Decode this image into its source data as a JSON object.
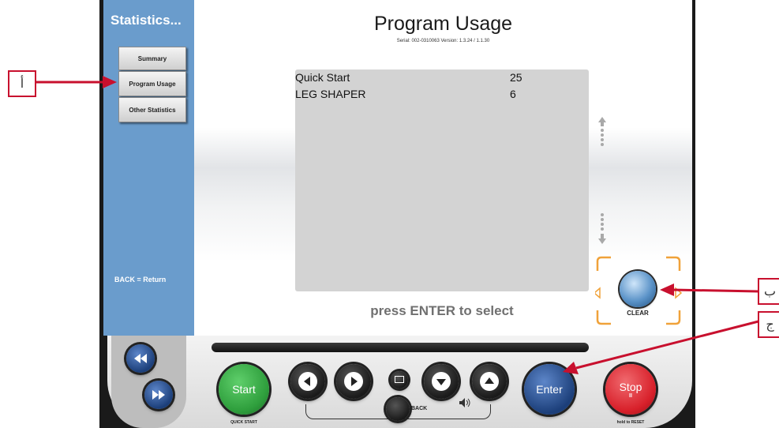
{
  "sidebar": {
    "title": "Statistics...",
    "items": [
      {
        "label": "Summary"
      },
      {
        "label": "Program Usage"
      },
      {
        "label": "Other Statistics"
      }
    ],
    "back_hint": "BACK = Return"
  },
  "screen": {
    "title": "Program Usage",
    "serial": "Serial: 002-0310063   Version: 1.3.24 / 1.1.30",
    "programs": [
      {
        "name": "Quick Start",
        "count": "25"
      },
      {
        "name": "LEG SHAPER",
        "count": "6"
      }
    ],
    "press_hint": "press ENTER to select",
    "clear_label": "CLEAR"
  },
  "console": {
    "start_label": "Start",
    "start_sub": "QUICK START",
    "back_label": "BACK",
    "enter_label": "Enter",
    "stop_label": "Stop",
    "stop_sub": "hold to RESET",
    "stop_pause": "II"
  },
  "annotations": {
    "a": "أ",
    "b": "ب",
    "c": "ج"
  },
  "colors": {
    "sidebar": "#6a9ccc",
    "accent_orange": "#f0a23a",
    "annotation_red": "#c8102e",
    "start_green": "#2e9e3c",
    "stop_red": "#d8202a",
    "enter_blue": "#1c3f7a"
  }
}
